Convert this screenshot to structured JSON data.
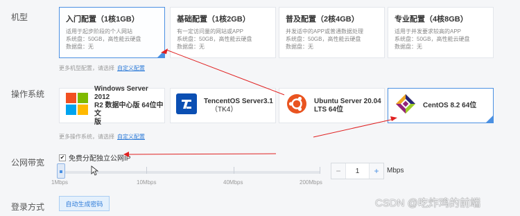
{
  "labels": {
    "model": "机型",
    "os": "操作系统",
    "bandwidth": "公网带宽",
    "login": "登录方式"
  },
  "configs": [
    {
      "title": "入门配置（1核1GB）",
      "desc": "适用于起步阶段的个人网站",
      "system_disk": "系统盘：50GB，高性能云硬盘",
      "data_disk": "数据盘：无"
    },
    {
      "title": "基础配置（1核2GB）",
      "desc": "有一定访问量的网站或APP",
      "system_disk": "系统盘：50GB，高性能云硬盘",
      "data_disk": "数据盘：无"
    },
    {
      "title": "普及配置（2核4GB）",
      "desc": "并发适中的APP或普通数据处理",
      "system_disk": "系统盘：50GB，高性能云硬盘",
      "data_disk": "数据盘：无"
    },
    {
      "title": "专业配置（4核8GB）",
      "desc": "适用于并发要求较高的APP",
      "system_disk": "系统盘：50GB，高性能云硬盘",
      "data_disk": "数据盘：无"
    }
  ],
  "config_hint": {
    "text": "更多机型配置，请选择",
    "link": "自定义配置"
  },
  "os_options": [
    {
      "line1": "Windows Server 2012",
      "line2": "R2 数据中心版 64位中文",
      "line3": "版",
      "icon": "windows-icon"
    },
    {
      "line1": "TencentOS Server3.1",
      "line2": "（TK4）",
      "icon": "tencentos-icon"
    },
    {
      "line1": "Ubuntu Server 20.04",
      "line2": "LTS 64位",
      "icon": "ubuntu-icon"
    },
    {
      "line1": "CentOS 8.2 64位",
      "icon": "centos-icon"
    }
  ],
  "os_hint": {
    "text": "更多操作系统，请选择",
    "link": "自定义配置"
  },
  "bandwidth": {
    "checkbox_label": "免费分配独立公网IP",
    "checked": true,
    "scale": [
      "1Mbps",
      "10Mbps",
      "40Mbps",
      "200Mbps"
    ],
    "value": "1",
    "minus": "−",
    "plus": "+",
    "unit": "Mbps"
  },
  "login": {
    "button": "自动生成密码"
  },
  "watermark": "CSDN @吃炸鸡的前端",
  "colors": {
    "accent": "#4a90e2",
    "annotation": "#e02020",
    "link": "#2f7cd8"
  }
}
